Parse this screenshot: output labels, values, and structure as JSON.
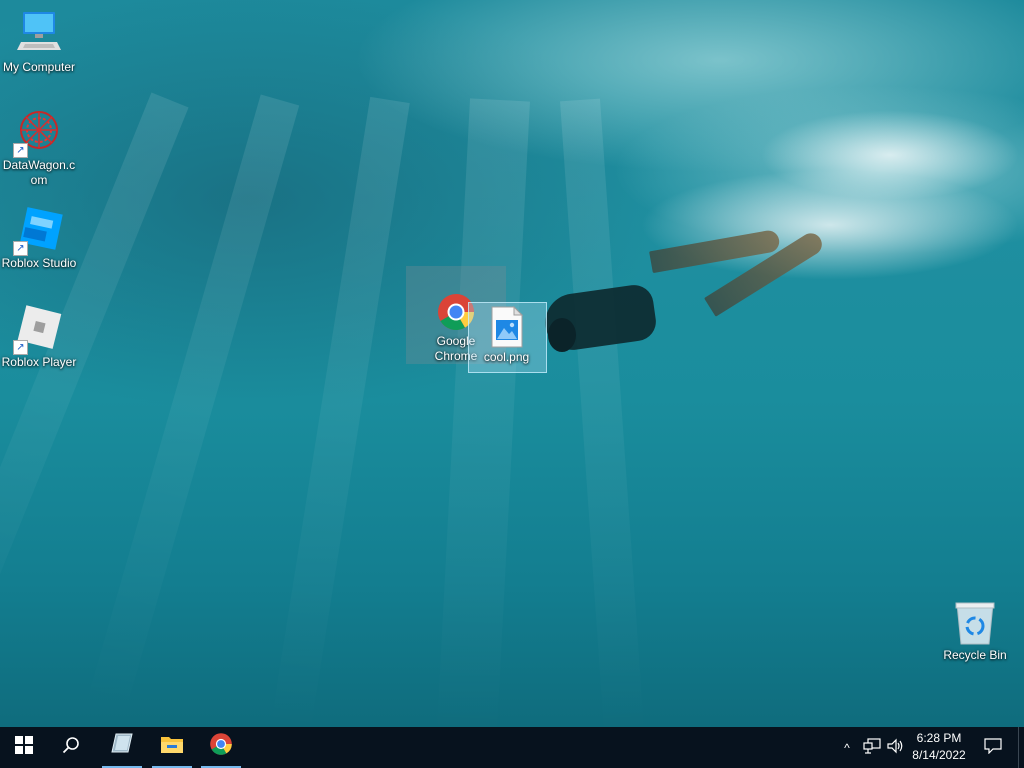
{
  "desktop": {
    "wallpaper": "underwater freediver",
    "icons": [
      {
        "label": "My Computer",
        "icon": "computer-icon",
        "shortcut": false
      },
      {
        "label": "DataWagon.c\nom",
        "icon": "datawagon-icon",
        "shortcut": true
      },
      {
        "label": "Roblox Studio",
        "icon": "roblox-studio-icon",
        "shortcut": true
      },
      {
        "label": "Roblox Player",
        "icon": "roblox-player-icon",
        "shortcut": true
      },
      {
        "label": "Google Chrome",
        "icon": "chrome-icon",
        "shortcut": false,
        "state": "dragging"
      },
      {
        "label": "cool.png",
        "icon": "image-file-icon",
        "shortcut": false,
        "state": "selected"
      },
      {
        "label": "Recycle Bin",
        "icon": "recycle-bin-icon",
        "shortcut": false
      }
    ]
  },
  "taskbar": {
    "start": "windows-start-icon",
    "search": "search-icon",
    "pinned": [
      {
        "name": "app-icon",
        "active": true
      },
      {
        "name": "file-explorer-icon",
        "active": true
      },
      {
        "name": "chrome-icon",
        "active": true
      }
    ],
    "tray": {
      "chevron": "^",
      "network": "network-icon",
      "volume": "volume-icon"
    },
    "clock": {
      "time": "6:28 PM",
      "date": "8/14/2022"
    },
    "notifications": "notification-icon"
  },
  "colors": {
    "taskbar": "#07121e",
    "accent": "#76b9ed",
    "water": "#1a8d9d"
  }
}
